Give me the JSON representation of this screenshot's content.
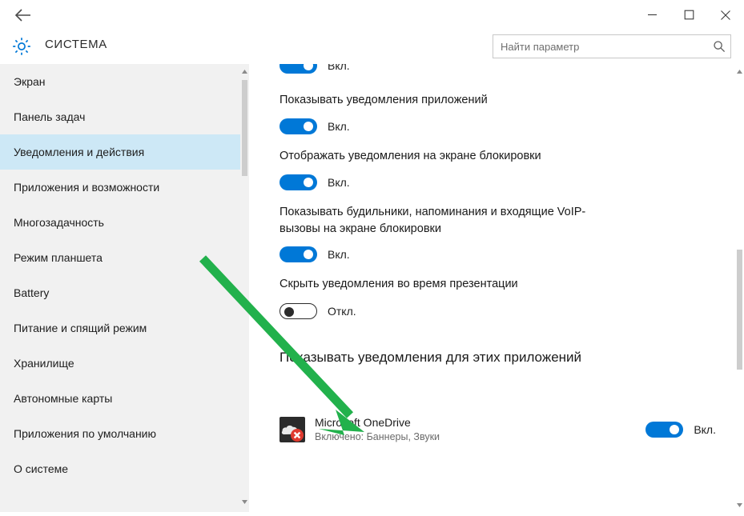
{
  "window": {
    "title": "СИСТЕМА",
    "back_icon": "back-arrow-icon",
    "gear_icon": "gear-icon",
    "minimize_label": "—",
    "maximize_label": "☐",
    "close_label": "✕"
  },
  "search": {
    "placeholder": "Найти параметр",
    "value": "",
    "icon": "search-icon"
  },
  "sidebar": {
    "items": [
      {
        "label": "Экран",
        "selected": false
      },
      {
        "label": "Панель задач",
        "selected": false
      },
      {
        "label": "Уведомления и действия",
        "selected": true
      },
      {
        "label": "Приложения и возможности",
        "selected": false
      },
      {
        "label": "Многозадачность",
        "selected": false
      },
      {
        "label": "Режим планшета",
        "selected": false
      },
      {
        "label": "Battery",
        "selected": false
      },
      {
        "label": "Питание и спящий режим",
        "selected": false
      },
      {
        "label": "Хранилище",
        "selected": false
      },
      {
        "label": "Автономные карты",
        "selected": false
      },
      {
        "label": "Приложения по умолчанию",
        "selected": false
      },
      {
        "label": "О системе",
        "selected": false
      }
    ],
    "scroll_up_icon": "chevron-up-icon",
    "scroll_down_icon": "chevron-down-icon"
  },
  "main": {
    "partial_top": {
      "state": "Вкл."
    },
    "settings": [
      {
        "label": "Показывать уведомления приложений",
        "state": "Вкл.",
        "on": true
      },
      {
        "label": "Отображать уведомления на экране блокировки",
        "state": "Вкл.",
        "on": true
      },
      {
        "label": "Показывать будильники, напоминания и входящие VoIP-вызовы на экране блокировки",
        "state": "Вкл.",
        "on": true
      },
      {
        "label": "Скрыть уведомления во время презентации",
        "state": "Откл.",
        "on": false
      }
    ],
    "section_heading": "Показывать уведомления для этих приложений",
    "apps": [
      {
        "name": "Microsoft OneDrive",
        "sub": "Включено: Баннеры, Звуки",
        "state": "Вкл.",
        "on": true,
        "icon": "onedrive-error-icon"
      }
    ],
    "scroll_up_icon": "chevron-up-icon",
    "scroll_down_icon": "chevron-down-icon"
  },
  "annotation": {
    "arrow_color": "#22b14c",
    "arrow_name": "green-annotation-arrow"
  },
  "colors": {
    "accent": "#0078d7",
    "selected_nav": "#cde8f6",
    "sidebar_bg": "#f1f1f1",
    "arrow_green": "#22b14c"
  }
}
